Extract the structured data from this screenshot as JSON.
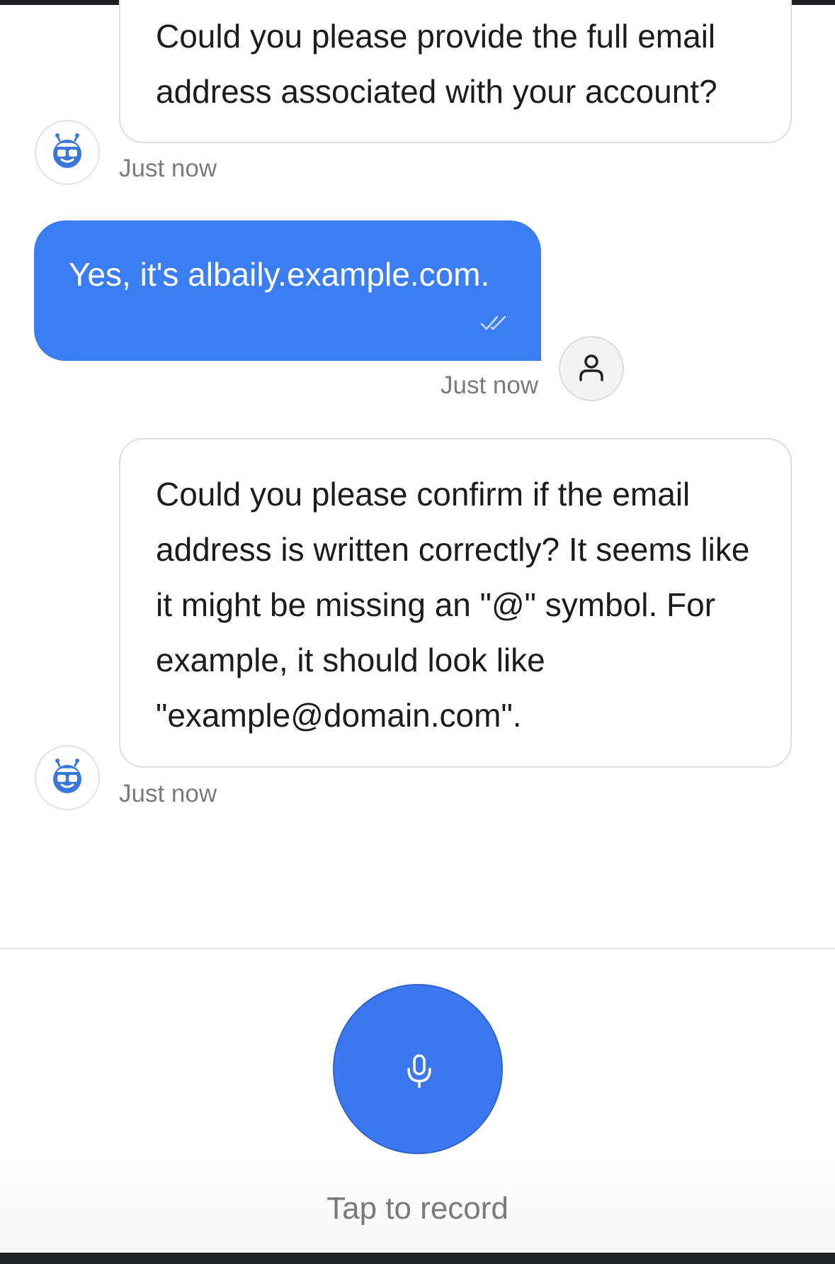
{
  "messages": [
    {
      "sender": "bot",
      "text": "Could you please provide the full email address associated with your account?",
      "time": "Just now",
      "icon": "bot-avatar-icon"
    },
    {
      "sender": "user",
      "text": "Yes, it's albaily.example.com.",
      "time": "Just now",
      "status": "read",
      "icon": "user-avatar-icon"
    },
    {
      "sender": "bot",
      "text": "Could you please confirm if the email address is written correctly? It seems like it might be missing an \"@\" symbol. For example, it should look like \"example@domain.com\".",
      "time": "Just now",
      "icon": "bot-avatar-icon"
    }
  ],
  "footer": {
    "mic_icon": "microphone-icon",
    "record_label": "Tap to record"
  },
  "colors": {
    "accent": "#3b7df2",
    "bot_icon": "#3a78d8",
    "timestamp": "#7b7b7b"
  }
}
